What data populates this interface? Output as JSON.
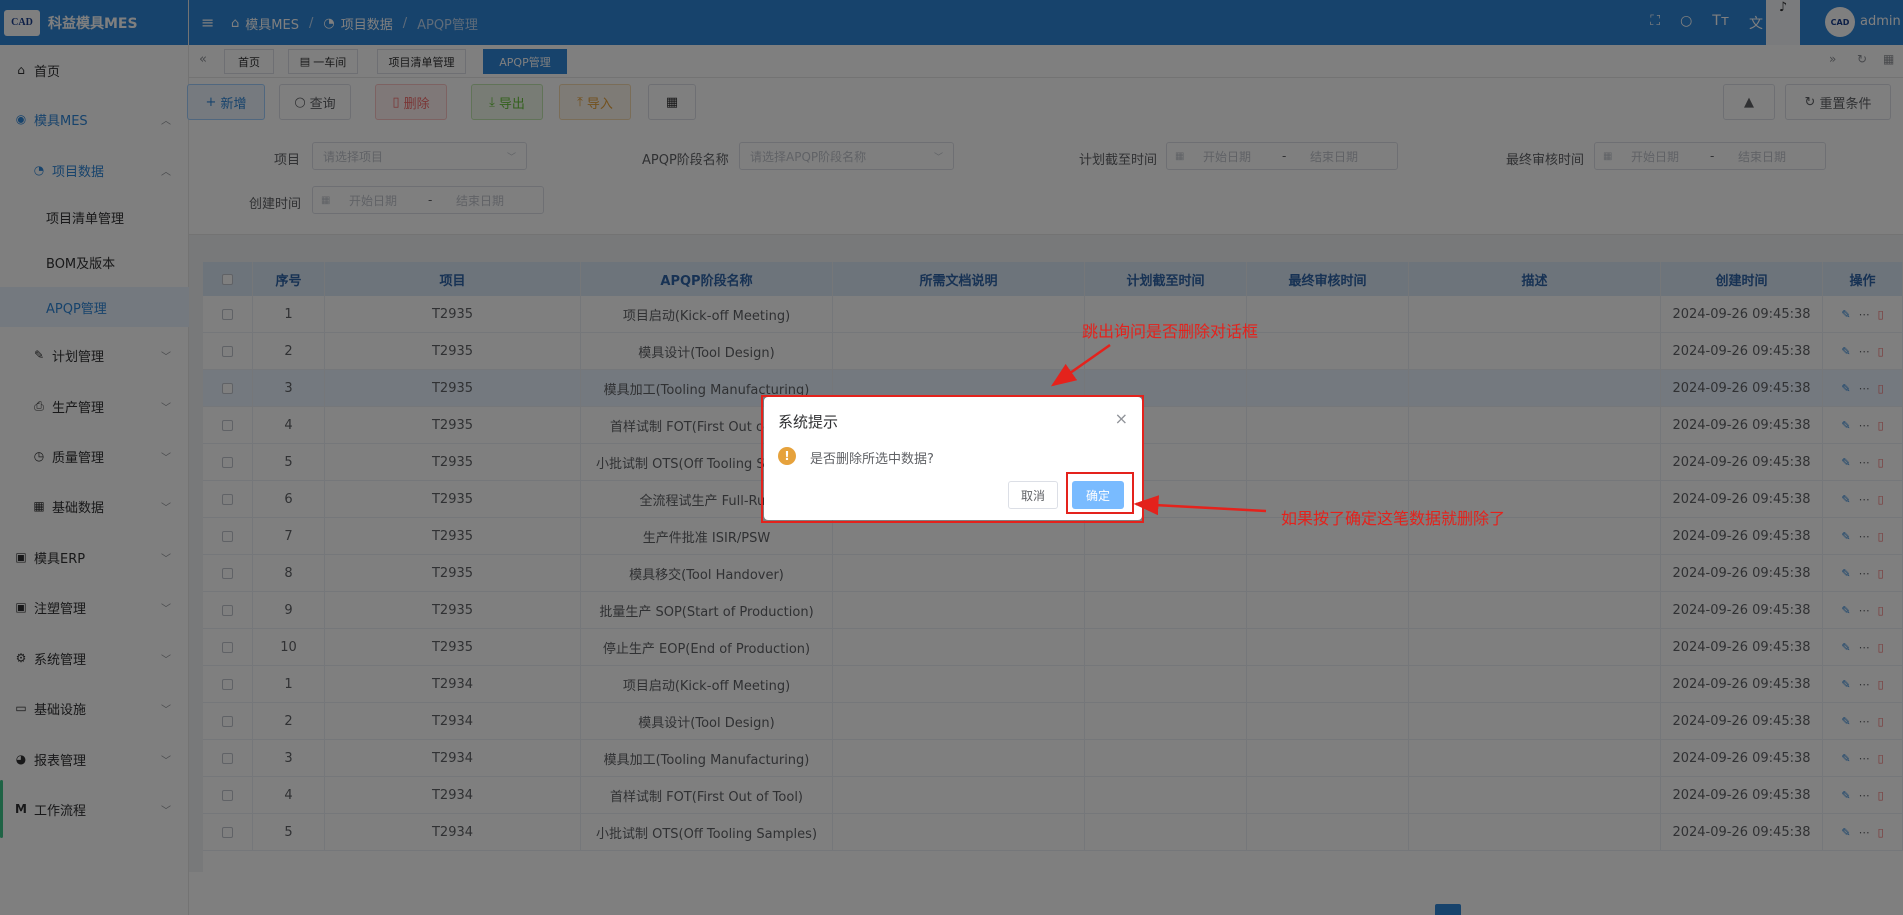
{
  "app": {
    "logo_text": "CAD",
    "title": "科益模具MES"
  },
  "sidebar": {
    "items": [
      {
        "label": "首页",
        "icon": "home-icon"
      },
      {
        "label": "模具MES",
        "icon": "camera-icon"
      },
      {
        "label": "项目数据",
        "icon": "clock-icon"
      },
      {
        "label": "项目清单管理"
      },
      {
        "label": "BOM及版本"
      },
      {
        "label": "APQP管理"
      },
      {
        "label": "计划管理",
        "icon": "edit-icon"
      },
      {
        "label": "生产管理",
        "icon": "printer-icon"
      },
      {
        "label": "质量管理",
        "icon": "timer-icon"
      },
      {
        "label": "基础数据",
        "icon": "calendar-icon"
      },
      {
        "label": "模具ERP",
        "icon": "briefcase-icon"
      },
      {
        "label": "注塑管理",
        "icon": "briefcase-icon"
      },
      {
        "label": "系统管理",
        "icon": "gear-icon"
      },
      {
        "label": "基础设施",
        "icon": "monitor-icon"
      },
      {
        "label": "报表管理",
        "icon": "chart-icon"
      },
      {
        "label": "工作流程",
        "icon": "logo-m-icon"
      }
    ]
  },
  "header": {
    "breadcrumb": [
      "模具MES",
      "项目数据",
      "APQP管理"
    ],
    "username": "admin"
  },
  "tabs": [
    "首页",
    "一车间",
    "项目清单管理",
    "APQP管理"
  ],
  "toolbar": {
    "add": "新增",
    "query": "查询",
    "delete": "删除",
    "export": "导出",
    "import": "导入",
    "reset": "重置条件"
  },
  "search": {
    "project_label": "项目",
    "project_placeholder": "请选择项目",
    "stage_label": "APQP阶段名称",
    "stage_placeholder": "请选择APQP阶段名称",
    "deadline_label": "计划截至时间",
    "review_label": "最终审核时间",
    "created_label": "创建时间",
    "start_placeholder": "开始日期",
    "end_placeholder": "结束日期",
    "range_sep": "-"
  },
  "table": {
    "columns": [
      "序号",
      "项目",
      "APQP阶段名称",
      "所需文档说明",
      "计划截至时间",
      "最终审核时间",
      "描述",
      "创建时间",
      "操作"
    ],
    "rows": [
      {
        "no": "1",
        "project": "T2935",
        "stage": "项目启动(Kick-off Meeting)",
        "created": "2024-09-26 09:45:38"
      },
      {
        "no": "2",
        "project": "T2935",
        "stage": "模具设计(Tool Design)",
        "created": "2024-09-26 09:45:38"
      },
      {
        "no": "3",
        "project": "T2935",
        "stage": "模具加工(Tooling Manufacturing)",
        "created": "2024-09-26 09:45:38"
      },
      {
        "no": "4",
        "project": "T2935",
        "stage": "首样试制 FOT(First Out of Tool)",
        "created": "2024-09-26 09:45:38"
      },
      {
        "no": "5",
        "project": "T2935",
        "stage": "小批试制 OTS(Off Tooling Samples)",
        "created": "2024-09-26 09:45:38"
      },
      {
        "no": "6",
        "project": "T2935",
        "stage": "全流程试生产 Full-Run",
        "created": "2024-09-26 09:45:38"
      },
      {
        "no": "7",
        "project": "T2935",
        "stage": "生产件批准 ISIR/PSW",
        "created": "2024-09-26 09:45:38"
      },
      {
        "no": "8",
        "project": "T2935",
        "stage": "模具移交(Tool Handover)",
        "created": "2024-09-26 09:45:38"
      },
      {
        "no": "9",
        "project": "T2935",
        "stage": "批量生产 SOP(Start of Production)",
        "created": "2024-09-26 09:45:38"
      },
      {
        "no": "10",
        "project": "T2935",
        "stage": "停止生产 EOP(End of Production)",
        "created": "2024-09-26 09:45:38"
      },
      {
        "no": "1",
        "project": "T2934",
        "stage": "项目启动(Kick-off Meeting)",
        "created": "2024-09-26 09:45:38"
      },
      {
        "no": "2",
        "project": "T2934",
        "stage": "模具设计(Tool Design)",
        "created": "2024-09-26 09:45:38"
      },
      {
        "no": "3",
        "project": "T2934",
        "stage": "模具加工(Tooling Manufacturing)",
        "created": "2024-09-26 09:45:38"
      },
      {
        "no": "4",
        "project": "T2934",
        "stage": "首样试制 FOT(First Out of Tool)",
        "created": "2024-09-26 09:45:38"
      },
      {
        "no": "5",
        "project": "T2934",
        "stage": "小批试制 OTS(Off Tooling Samples)",
        "created": "2024-09-26 09:45:38"
      }
    ]
  },
  "dialog": {
    "title": "系统提示",
    "message": "是否删除所选中数据?",
    "cancel": "取消",
    "confirm": "确定"
  },
  "annotations": {
    "top": "跳出询问是否删除对话框",
    "right": "如果按了确定这笔数据就删除了"
  },
  "colors": {
    "primary": "#2f86d8",
    "annotation": "#e4221c",
    "warning": "#e6a23c",
    "danger": "#f56c6c"
  }
}
